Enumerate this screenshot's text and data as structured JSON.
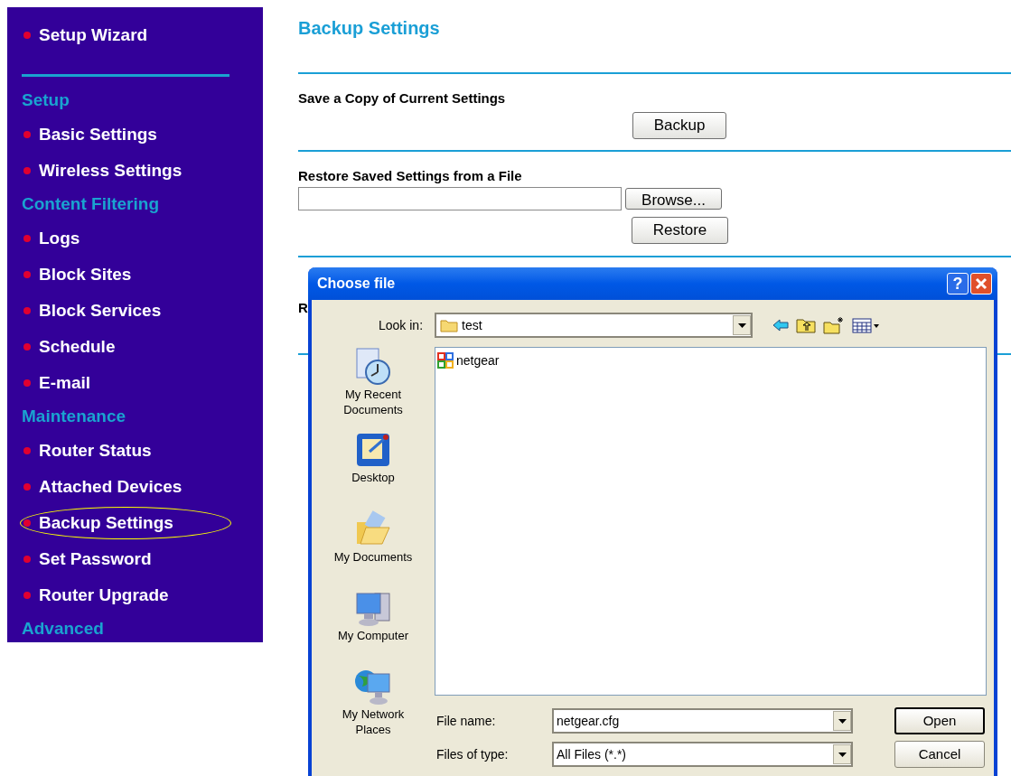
{
  "sidebar": {
    "top_item": {
      "label": "Setup Wizard"
    },
    "sections": [
      {
        "title": "Setup",
        "items": [
          {
            "label": "Basic Settings",
            "selected": false
          },
          {
            "label": "Wireless Settings",
            "selected": false
          }
        ]
      },
      {
        "title": "Content Filtering",
        "items": [
          {
            "label": "Logs",
            "selected": false
          },
          {
            "label": "Block Sites",
            "selected": false
          },
          {
            "label": "Block Services",
            "selected": false
          },
          {
            "label": "Schedule",
            "selected": false
          },
          {
            "label": "E-mail",
            "selected": false
          }
        ]
      },
      {
        "title": "Maintenance",
        "items": [
          {
            "label": "Router Status",
            "selected": false
          },
          {
            "label": "Attached Devices",
            "selected": false
          },
          {
            "label": "Backup Settings",
            "selected": true
          },
          {
            "label": "Set Password",
            "selected": false
          },
          {
            "label": "Router Upgrade",
            "selected": false
          }
        ]
      },
      {
        "title": "Advanced"
      }
    ]
  },
  "page": {
    "title": "Backup Settings",
    "save_section": {
      "heading": "Save a Copy of Current Settings",
      "button": "Backup"
    },
    "restore_section": {
      "heading": "Restore Saved Settings from a File",
      "browse_button": "Browse...",
      "restore_button": "Restore"
    },
    "third_section": {
      "heading": "R"
    }
  },
  "dialog": {
    "title": "Choose file",
    "help_button": "?",
    "look_in": {
      "label": "Look in:",
      "value": "test"
    },
    "places": [
      {
        "kind": "recent",
        "label": "My Recent Documents"
      },
      {
        "kind": "desktop",
        "label": "Desktop"
      },
      {
        "kind": "documents",
        "label": "My Documents"
      },
      {
        "kind": "computer",
        "label": "My Computer"
      },
      {
        "kind": "network",
        "label": "My Network Places"
      }
    ],
    "files": [
      {
        "name": "netgear"
      }
    ],
    "file_name": {
      "label": "File name:",
      "value": "netgear.cfg"
    },
    "file_type": {
      "label": "Files of type:",
      "value": "All Files (*.*)"
    },
    "buttons": {
      "open": "Open",
      "cancel": "Cancel"
    }
  }
}
